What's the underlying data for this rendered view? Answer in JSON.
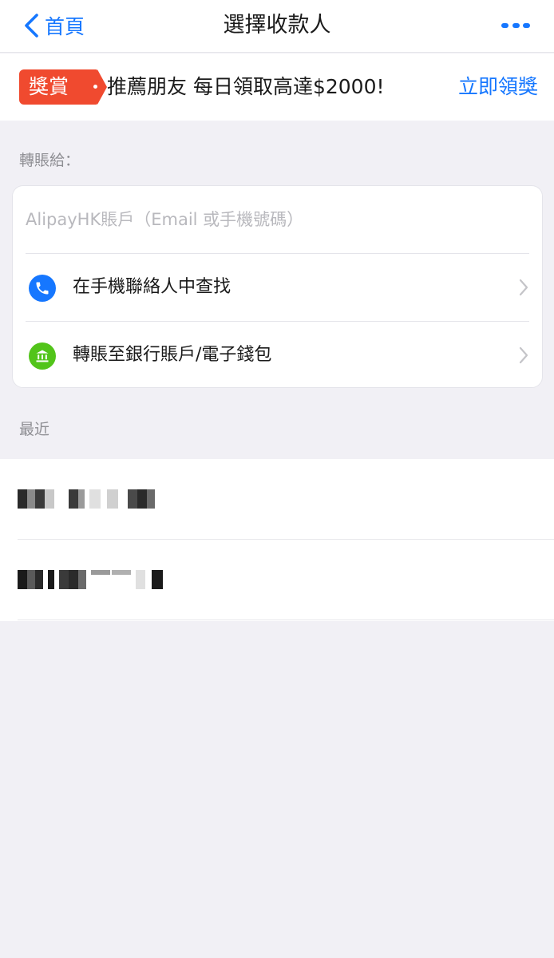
{
  "navbar": {
    "back_label": "首頁",
    "title": "選擇收款人",
    "more_icon": "more-icon",
    "accent_color": "#1677ff"
  },
  "banner": {
    "badge": "獎賞",
    "text": "推薦朋友 每日領取高達$2000!",
    "cta": "立即領獎",
    "badge_color": "#f04a2f"
  },
  "transfer": {
    "section_label": "轉賬給：",
    "account_placeholder": "AlipayHK賬戶（Email 或手機號碼）",
    "options": [
      {
        "label": "在手機聯絡人中查找",
        "icon": "phone-icon",
        "color": "#1677ff"
      },
      {
        "label": "轉賬至銀行賬戶/電子錢包",
        "icon": "bank-icon",
        "color": "#52c41a"
      }
    ]
  },
  "recent": {
    "section_label": "最近",
    "items": [
      {
        "name": "",
        "redacted": true
      },
      {
        "name": "",
        "redacted": true
      }
    ]
  }
}
